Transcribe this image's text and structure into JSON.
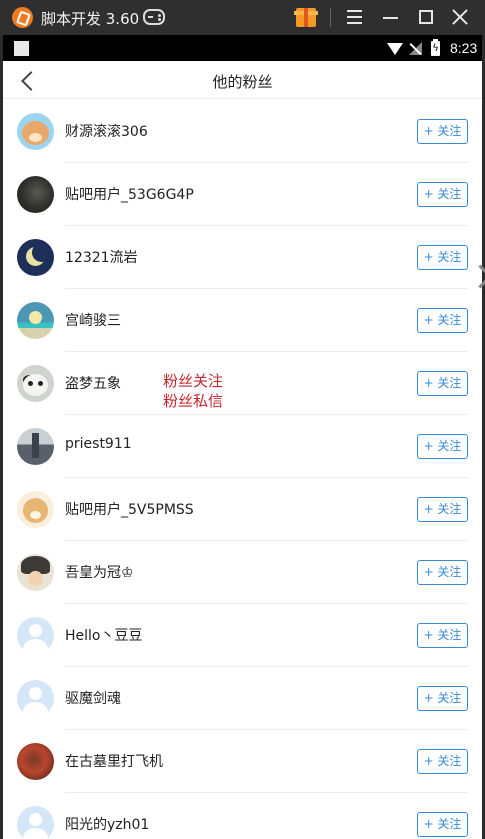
{
  "emulator": {
    "title": "脚本开发 3.60"
  },
  "status_bar": {
    "time": "8:23"
  },
  "header": {
    "title": "他的粉丝"
  },
  "follow_label": "+ 关注",
  "fans": [
    {
      "name": "财源滚滚306",
      "avatar": "bear-avatar"
    },
    {
      "name": "贴吧用户_53G6G4P",
      "avatar": "dark-photo-avatar"
    },
    {
      "name": "12321流岩",
      "avatar": "moon-avatar"
    },
    {
      "name": "宫崎骏三",
      "avatar": "seaside-avatar"
    },
    {
      "name": "盗梦五象",
      "avatar": "panda-avatar"
    },
    {
      "name": "priest911",
      "avatar": "church-avatar"
    },
    {
      "name": "贴吧用户_5V5PMSS",
      "avatar": "bear-avatar"
    },
    {
      "name": "吾皇为冠♔",
      "avatar": "anime-avatar"
    },
    {
      "name": "Hello丶豆豆",
      "avatar": "default-avatar"
    },
    {
      "name": "驱魔剑魂",
      "avatar": "default-avatar"
    },
    {
      "name": "在古墓里打飞机",
      "avatar": "red-photo-avatar"
    },
    {
      "name": "阳光的yzh01",
      "avatar": "default-avatar"
    }
  ],
  "overlay_menu": {
    "items": [
      "粉丝关注",
      "粉丝私信"
    ],
    "color": "#c1272d"
  },
  "colors": {
    "accent": "#3a8ad8",
    "emulator_bar": "#2f2f2f"
  }
}
